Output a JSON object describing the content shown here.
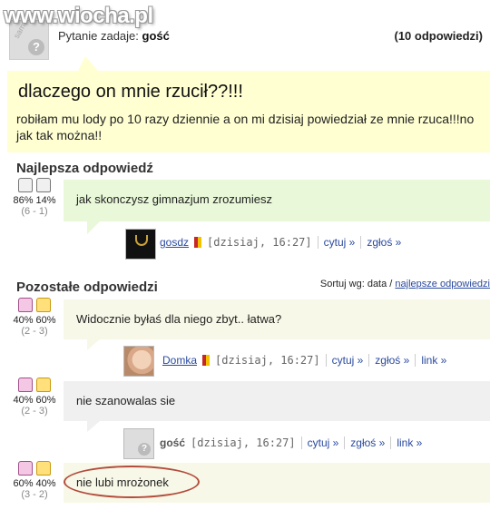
{
  "watermark": "www.wiocha.pl",
  "question": {
    "asker_label": "Pytanie zadaje:",
    "asker_name": "gość",
    "answers_count": "(10 odpowiedzi)",
    "title": "dlaczego on mnie rzucił??!!!",
    "body": "robiłam mu lody po 10 razy dziennie a on mi dzisiaj powiedział ze mnie rzuca!!!no jak tak można!!"
  },
  "best": {
    "heading": "Najlepsza odpowiedź",
    "votes": {
      "percent": "86% 14%",
      "count": "(6 - 1)"
    },
    "text": "jak skonczysz gimnazjum zrozumiesz",
    "author": "gosdz",
    "date": "[dzisiaj, 16:27]",
    "quote": "cytuj »",
    "report": "zgłoś »"
  },
  "others": {
    "heading": "Pozostałe odpowiedzi",
    "sort_label": "Sortuj wg: data /",
    "sort_link": "najlepsze odpowiedzi",
    "items": [
      {
        "votes": "40% 60%",
        "count": "(2 - 3)",
        "text": "Widocznie byłaś dla niego zbyt.. łatwa?",
        "author": "Domka",
        "date": "[dzisiaj, 16:27]",
        "quote": "cytuj »",
        "report": "zgłoś »",
        "link": "link »"
      },
      {
        "votes": "40% 60%",
        "count": "(2 - 3)",
        "text": "nie szanowalas sie",
        "author": "gość",
        "date": "[dzisiaj, 16:27]",
        "quote": "cytuj »",
        "report": "zgłoś »",
        "link": "link »"
      },
      {
        "votes": "60% 40%",
        "count": "(3 - 2)",
        "text": "nie lubi mrożonek"
      }
    ]
  },
  "avatar_labels": {
    "anon": "samosia",
    "brand": "gosdz"
  },
  "colors": {
    "question_bg": "#ffffd2",
    "best_bg": "#e8f8d8",
    "link": "#2a4aa0",
    "highlight_circle": "#b34c3c"
  }
}
